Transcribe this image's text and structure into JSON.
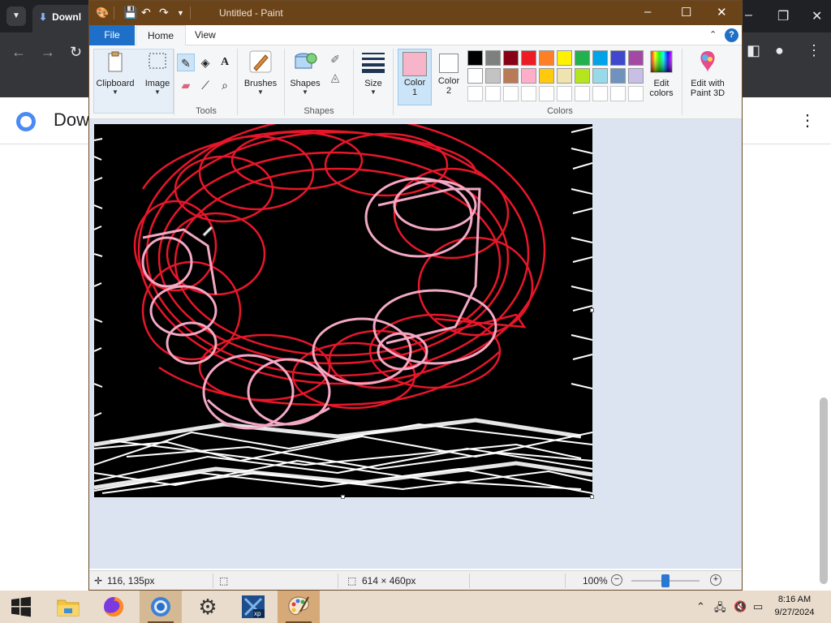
{
  "browser": {
    "tab_title": "Downl",
    "page_title": "Dow",
    "menu_icon": "kebab-icon"
  },
  "paint": {
    "window_title": "Untitled - Paint",
    "ribbon_tabs": {
      "file": "File",
      "home": "Home",
      "view": "View"
    },
    "groups": {
      "clipboard": "Clipboard",
      "image": "Image",
      "tools": "Tools",
      "brushes": "Brushes",
      "shapes_btn": "Shapes",
      "shapes_group": "Shapes",
      "size": "Size",
      "colors": "Colors",
      "color1": "Color",
      "color1_num": "1",
      "color2": "Color",
      "color2_num": "2",
      "edit_colors_1": "Edit",
      "edit_colors_2": "colors",
      "paint3d_1": "Edit with",
      "paint3d_2": "Paint 3D"
    },
    "color1_value": "#f7b5c9",
    "color2_value": "#ffffff",
    "palette_row1": [
      "#000000",
      "#7f7f7f",
      "#880015",
      "#ed1c24",
      "#ff7f27",
      "#fff200",
      "#22b14c",
      "#00a2e8",
      "#3f48cc",
      "#a349a4"
    ],
    "palette_row2": [
      "#ffffff",
      "#c3c3c3",
      "#b97a57",
      "#ffaec9",
      "#ffc90e",
      "#efe4b0",
      "#b5e61d",
      "#99d9ea",
      "#7092be",
      "#c8bfe7"
    ],
    "status": {
      "cursor_pos": "116, 135px",
      "image_size": "614 × 460px",
      "zoom": "100%"
    }
  },
  "taskbar": {
    "time": "8:16 AM",
    "date": "9/27/2024"
  }
}
